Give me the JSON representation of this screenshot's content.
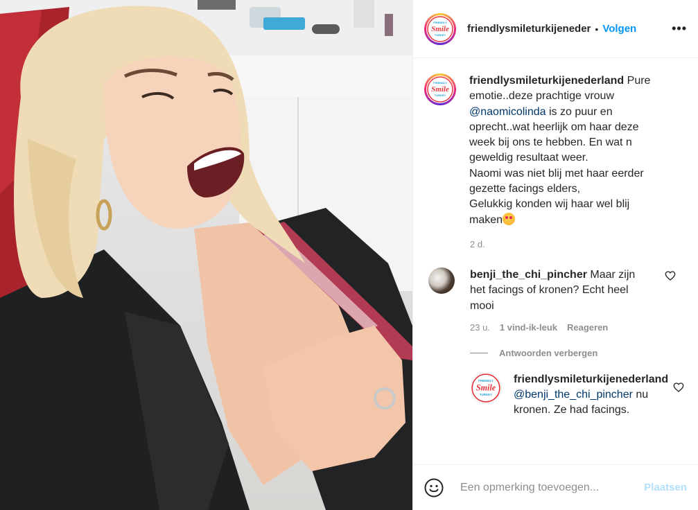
{
  "account": {
    "username": "friendlysmileturkijeneder",
    "full_username": "friendlysmileturkijenederland",
    "logo_text": "Smile",
    "logo_top": "FRIENDLY",
    "logo_bottom": "TURKEY",
    "separator": "•",
    "follow_label": "Volgen",
    "more_label": "•••"
  },
  "caption": {
    "text_1": "Pure emotie..deze prachtige vrouw",
    "mention": "@naomicolinda",
    "text_2": "is zo puur en oprecht..wat heerlijk om haar deze week bij ons te hebben. En wat n geweldig resultaat weer.",
    "text_3": "Naomi was niet blij met haar eerder gezette facings elders,",
    "text_4": "Gelukkig konden wij haar wel blij maken",
    "time": "2 d."
  },
  "comment": {
    "username": "benji_the_chi_pincher",
    "text": "Maar zijn het facings of kronen? Echt heel mooi",
    "time": "23 u.",
    "likes": "1 vind-ik-leuk",
    "reply_label": "Reageren",
    "hide_replies_label": "Antwoorden verbergen"
  },
  "reply": {
    "username": "friendlysmileturkijenederland",
    "mention": "@benji_the_chi_pincher",
    "text": "nu kronen. Ze had facings."
  },
  "footer": {
    "placeholder": "Een opmerking toevoegen...",
    "post_label": "Plaatsen"
  },
  "colors": {
    "link": "#0095f6",
    "mention": "#00376b",
    "muted": "#8e8e8e",
    "post_disabled": "#b2dffc"
  },
  "icons": {
    "emoji_picker": "smiley-face-icon",
    "like": "heart-icon",
    "options": "more-options-icon"
  }
}
